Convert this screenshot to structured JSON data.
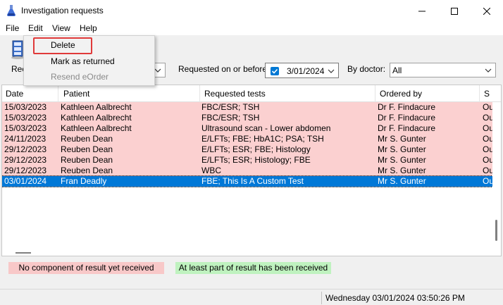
{
  "window": {
    "title": "Investigation requests"
  },
  "menu": {
    "items": [
      "File",
      "Edit",
      "View",
      "Help"
    ]
  },
  "edit_menu": {
    "items": [
      {
        "label": "Delete",
        "enabled": true,
        "highlighted": true
      },
      {
        "label": "Mark as returned",
        "enabled": true
      },
      {
        "label": "Resend eOrder",
        "enabled": false
      }
    ]
  },
  "filters": {
    "first_label": "Rec",
    "requested_label": "Requested on or before:",
    "requested_checked": true,
    "requested_date": "3/01/2024",
    "doctor_label": "By doctor:",
    "doctor_value": "All"
  },
  "table": {
    "columns": [
      "Date",
      "Patient",
      "Requested tests",
      "Ordered by",
      "S"
    ],
    "rows": [
      {
        "date": "15/03/2023",
        "patient": "Kathleen Aalbrecht",
        "tests": "FBC/ESR; TSH",
        "ordered_by": "Dr F. Findacure",
        "status": "Ou",
        "state": "pending"
      },
      {
        "date": "15/03/2023",
        "patient": "Kathleen Aalbrecht",
        "tests": "FBC/ESR; TSH",
        "ordered_by": "Dr F. Findacure",
        "status": "Ou",
        "state": "pending"
      },
      {
        "date": "15/03/2023",
        "patient": "Kathleen Aalbrecht",
        "tests": "Ultrasound scan - Lower abdomen",
        "ordered_by": "Dr F. Findacure",
        "status": "Ou",
        "state": "pending"
      },
      {
        "date": "24/11/2023",
        "patient": "Reuben Dean",
        "tests": "E/LFTs; FBE; HbA1C; PSA; TSH",
        "ordered_by": "Mr S. Gunter",
        "status": "Ou",
        "state": "pending"
      },
      {
        "date": "29/12/2023",
        "patient": "Reuben Dean",
        "tests": "E/LFTs; ESR; FBE; Histology",
        "ordered_by": "Mr S. Gunter",
        "status": "Ou",
        "state": "pending"
      },
      {
        "date": "29/12/2023",
        "patient": "Reuben Dean",
        "tests": "E/LFTs; ESR; Histology; FBE",
        "ordered_by": "Mr S. Gunter",
        "status": "Ou",
        "state": "pending"
      },
      {
        "date": "29/12/2023",
        "patient": "Reuben Dean",
        "tests": "WBC",
        "ordered_by": "Mr S. Gunter",
        "status": "Ou",
        "state": "pending"
      },
      {
        "date": "03/01/2024",
        "patient": "Fran Deadly",
        "tests": "FBE; This Is A Custom Test",
        "ordered_by": "Mr S. Gunter",
        "status": "Ou",
        "state": "selected"
      }
    ]
  },
  "legend": {
    "none_received": "No component of result yet received",
    "part_received": "At least part of result has been received"
  },
  "status_bar": {
    "datetime": "Wednesday 03/01/2024 03:50:26 PM"
  },
  "colors": {
    "pending_row": "#fbd0d0",
    "selected_row": "#0078d7",
    "legend_red": "#f8c8c8",
    "legend_green": "#bff2bf",
    "highlight_border": "#e03a3a"
  }
}
